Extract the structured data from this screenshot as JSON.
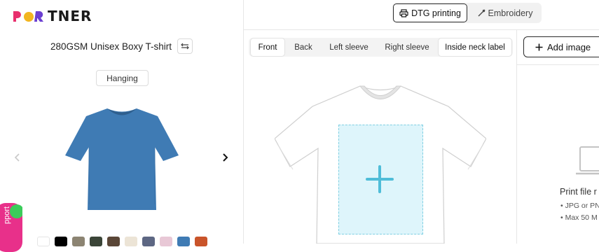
{
  "brand": {
    "logo_text": "TNER"
  },
  "product": {
    "name": "280GSM Unisex Boxy T-shirt",
    "view_label": "Hanging",
    "shirt_color": "#3f7bb4",
    "swatches": [
      "#ffffff",
      "#000000",
      "#8c8472",
      "#3b4538",
      "#5a4637",
      "#ece4d6",
      "#5d6783",
      "#e8c8d6",
      "#3f7bb4",
      "#c9542a"
    ]
  },
  "technique_tabs": {
    "dtg": "DTG printing",
    "embroidery": "Embroidery"
  },
  "side_tabs": [
    "Front",
    "Back",
    "Left sleeve",
    "Right sleeve",
    "Inside neck label"
  ],
  "right": {
    "add_image": "Add image",
    "print_file_title": "Print file r",
    "req1": "• JPG or PN",
    "req2": "• Max 50 M"
  },
  "support": {
    "label": "pport"
  },
  "colors": {
    "accent": "#2b2b2b",
    "print_area": "#def5fb",
    "plus": "#4fbdd8"
  }
}
